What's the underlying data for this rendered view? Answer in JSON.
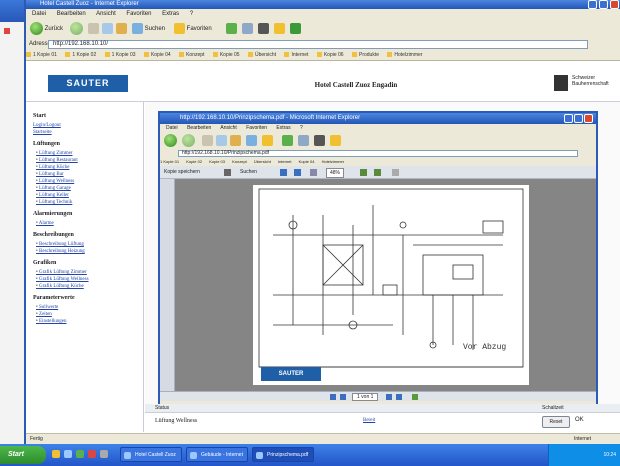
{
  "browser": {
    "title": "Hotel Castell Zuoz - Internet Explorer",
    "menu": [
      "Datei",
      "Bearbeiten",
      "Ansicht",
      "Favoriten",
      "Extras",
      "?"
    ],
    "toolbar": {
      "back_label": "Zurück",
      "search_label": "Suchen",
      "favorites_label": "Favoriten"
    },
    "address_label": "Adresse",
    "address_value": "http://192.168.10.10/",
    "links": [
      "1 Kopie 01",
      "1 Kopie 02",
      "1 Kopie 03",
      "Kopie 04",
      "Konzept",
      "Kopie 05",
      "Übersicht",
      "Internet",
      "Kopie 06",
      "Produkte",
      "Hotelzimmer"
    ]
  },
  "page": {
    "logo": "SAUTER",
    "title": "Hotel Castell Zuoz Engadin",
    "crest_text": "Schweizer Bauherrenschaft"
  },
  "sidebar": {
    "start_heading": "Start",
    "start_links": [
      "Login/Logout",
      "Startseite"
    ],
    "lueftung_heading": "Lüftungen",
    "lueftung_items": [
      "Lüftung Zimmer",
      "Lüftung Restaurant",
      "Lüftung Küche",
      "Lüftung Bar",
      "Lüftung Wellness",
      "Lüftung Garage",
      "Lüftung Keller",
      "Lüftung Technik"
    ],
    "alarm_heading": "Alarmierungen",
    "alarm_items": [
      "Alarme"
    ],
    "beschreib_heading": "Beschreibungen",
    "beschreib_items": [
      "Beschreibung Lüftung",
      "Beschreibung Heizung"
    ],
    "grafik_heading": "Grafiken",
    "grafik_items": [
      "Grafik Lüftung Zimmer",
      "Grafik Lüftung Wellness",
      "Grafik Lüftung Küche"
    ],
    "param_heading": "Parameterwerte",
    "param_items": [
      "Sollwerte",
      "Zeiten",
      "Einstellungen"
    ]
  },
  "popup": {
    "title": "http://192.168.10.10/Prinzipschema.pdf - Microsoft Internet Explorer",
    "menu": [
      "Datei",
      "Bearbeiten",
      "Ansicht",
      "Favoriten",
      "Extras",
      "?"
    ],
    "address_value": "http://192.168.10.10/Prinzipschema.pdf",
    "links": [
      "1 Kopie 01",
      "Kopie 02",
      "Kopie 03",
      "Konzept",
      "Übersicht",
      "Internet",
      "Kopie 04",
      "Hotelzimmer"
    ],
    "pdf_toolbar": {
      "save_label": "Kopie speichern",
      "search_label": "Suchen",
      "zoom": "48%"
    },
    "pdf_status_page": "1 von 1",
    "pdf_footer_logo": "SAUTER",
    "pdf_annotation": "Vor Abzug"
  },
  "bottom": {
    "label": "Lüftung Wellness",
    "link": "Bereit",
    "reset_label": "Reset",
    "ok_label": "OK",
    "col_header_left": "Status",
    "col_header_right": "Schaltzeit"
  },
  "status_bar": {
    "left": "Fertig",
    "right": "Internet"
  },
  "taskbar": {
    "start_label": "Start",
    "tasks": [
      "Hotel Castell Zuoz",
      "Gebäude - Internet",
      "Prinzipschema.pdf"
    ],
    "clock": "10:24"
  }
}
